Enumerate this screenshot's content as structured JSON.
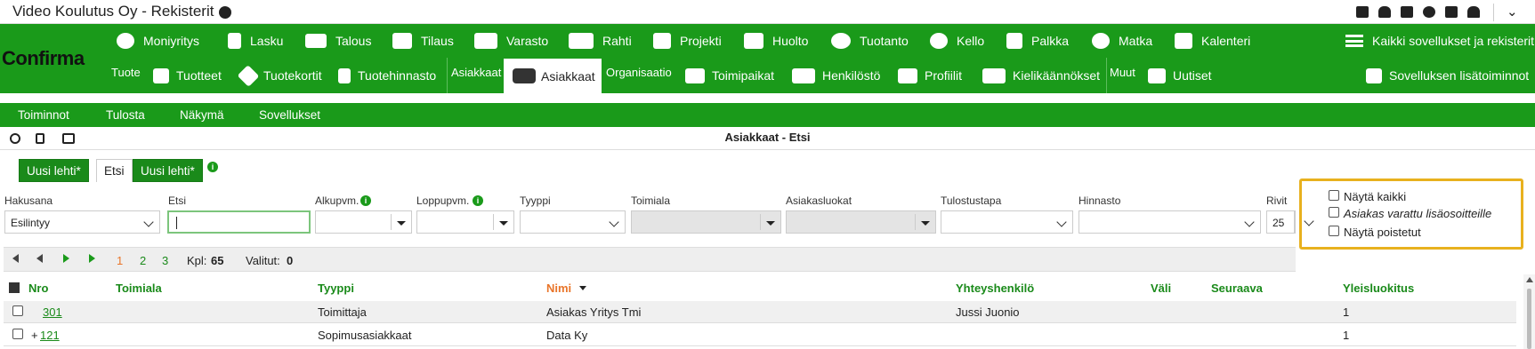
{
  "window": {
    "title": "Video Koulutus Oy - Rekisterit"
  },
  "brand": {
    "logo": "Confirma",
    "accent": "#1a9a1a",
    "highlight": "#e8b11e"
  },
  "nav1": [
    {
      "label": "Moniyritys",
      "icon": "cloud-upload-icon"
    },
    {
      "label": "Lasku",
      "icon": "document-icon"
    },
    {
      "label": "Talous",
      "icon": "money-icon"
    },
    {
      "label": "Tilaus",
      "icon": "grid-icon"
    },
    {
      "label": "Varasto",
      "icon": "boxes-icon"
    },
    {
      "label": "Rahti",
      "icon": "truck-icon"
    },
    {
      "label": "Projekti",
      "icon": "checklist-icon"
    },
    {
      "label": "Huolto",
      "icon": "wrench-icon"
    },
    {
      "label": "Tuotanto",
      "icon": "cube-icon"
    },
    {
      "label": "Kello",
      "icon": "clock-icon"
    },
    {
      "label": "Palkka",
      "icon": "flag-icon"
    },
    {
      "label": "Matka",
      "icon": "globe-icon"
    },
    {
      "label": "Kalenteri",
      "icon": "calendar-icon"
    }
  ],
  "all_apps": "Kaikki sovellukset ja rekisterit",
  "app_more": "Sovelluksen lisätoiminnot",
  "nav2_groups": {
    "tuote": "Tuote",
    "asiakkaat": "Asiakkaat",
    "organisaatio": "Organisaatio",
    "muut": "Muut"
  },
  "nav2": {
    "tuotteet": "Tuotteet",
    "tuotekortit": "Tuotekortit",
    "tuotehinnasto": "Tuotehinnasto",
    "asiakkaat": "Asiakkaat",
    "toimipaikat": "Toimipaikat",
    "henkilosto": "Henkilöstö",
    "profiilit": "Profiilit",
    "kielikaannokset": "Kielikäännökset",
    "uutiset": "Uutiset"
  },
  "menu": {
    "toiminnot": "Toiminnot",
    "tulosta": "Tulosta",
    "nakyma": "Näkymä",
    "sovellukset": "Sovellukset"
  },
  "page_title": "Asiakkaat - Etsi",
  "tabs": {
    "uusi1": "Uusi lehti*",
    "etsi": "Etsi",
    "uusi2": "Uusi lehti*"
  },
  "filters": {
    "hakusana": {
      "label": "Hakusana",
      "value": "Esilintyy"
    },
    "etsi": {
      "label": "Etsi",
      "value": ""
    },
    "alkupvm": {
      "label": "Alkupvm."
    },
    "loppupvm": {
      "label": "Loppupvm."
    },
    "tyyppi": {
      "label": "Tyyppi"
    },
    "toimiala": {
      "label": "Toimiala"
    },
    "asiakasluokat": {
      "label": "Asiakasluokat"
    },
    "tulostustapa": {
      "label": "Tulostustapa"
    },
    "hinnasto": {
      "label": "Hinnasto"
    },
    "rivit": {
      "label": "Rivit",
      "value": "25"
    }
  },
  "options": {
    "nayta_kaikki": "Näytä kaikki",
    "varattu": "Asiakas varattu lisäosoitteille",
    "poistetut": "Näytä poistetut"
  },
  "pager": {
    "pages": [
      "1",
      "2",
      "3"
    ],
    "kpl_label": "Kpl:",
    "kpl": "65",
    "valitut_label": "Valitut:",
    "valitut": "0"
  },
  "columns": [
    "Nro",
    "Toimiala",
    "Tyyppi",
    "Nimi",
    "Yhteyshenkilö",
    "Väli",
    "Seuraava",
    "Yleisluokitus"
  ],
  "rows": [
    {
      "nro": "301",
      "toimiala": "",
      "tyyppi": "Toimittaja",
      "nimi": "Asiakas Yritys Tmi",
      "yhteys": "Jussi Juonio",
      "yleis": "1"
    },
    {
      "nro": "121",
      "prefix": "+",
      "toimiala": "",
      "tyyppi": "Sopimusasiakkaat",
      "nimi": "Data Ky",
      "yhteys": "",
      "yleis": "1"
    }
  ]
}
